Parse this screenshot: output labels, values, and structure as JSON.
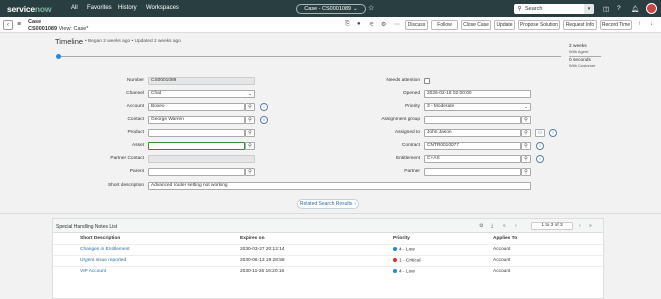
{
  "nav": {
    "logo_service": "service",
    "logo_now": "now",
    "links": [
      "All",
      "Favorites",
      "History",
      "Workspaces"
    ],
    "context_chip": "Case - CS0001089",
    "search_placeholder": "Search"
  },
  "form_header": {
    "record_type": "Case",
    "record_number": "CS0001089",
    "view_label": "View: Case*",
    "buttons": [
      "Discuss",
      "Follow",
      "Close Case",
      "Update",
      "Propose Solution",
      "Request Info",
      "Record Time"
    ]
  },
  "timeline": {
    "title": "Timeline",
    "subtitle": "• Began 2 weeks ago • Updated 2 weeks ago",
    "sla": [
      {
        "value": "2 weeks",
        "label": "With Agent"
      },
      {
        "value": "0 seconds",
        "label": "With Customer"
      }
    ]
  },
  "form": {
    "left": {
      "number": {
        "label": "Number",
        "value": "CS0001089"
      },
      "channel": {
        "label": "Channel",
        "value": "Chat"
      },
      "account": {
        "label": "Account",
        "value": "Boxeo"
      },
      "contact": {
        "label": "Contact",
        "value": "George Warren"
      },
      "product": {
        "label": "Product",
        "value": ""
      },
      "asset": {
        "label": "Asset",
        "value": ""
      },
      "partner_contact": {
        "label": "Partner Contact",
        "value": ""
      },
      "parent": {
        "label": "Parent",
        "value": ""
      },
      "short_description": {
        "label": "Short description",
        "value": "Advanced router setting not working"
      }
    },
    "right": {
      "needs_attention": {
        "label": "Needs attention",
        "checked": false
      },
      "opened": {
        "label": "Opened",
        "value": "2026-02-18 02:00:00"
      },
      "priority": {
        "label": "Priority",
        "value": "3 - Moderate"
      },
      "assignment_group": {
        "label": "Assignment group",
        "value": ""
      },
      "assigned_to": {
        "label": "Assigned to",
        "value": "John Jason"
      },
      "contract": {
        "label": "Contract",
        "value": "CNTR0010077"
      },
      "entitlement": {
        "label": "Entitlement",
        "value": "C+AS"
      },
      "partner": {
        "label": "Partner",
        "value": ""
      }
    }
  },
  "related_search": "Related Search Results",
  "list": {
    "title": "Special Handling Notes List",
    "pager_text": "1  to 3 of 3",
    "columns": [
      "Short Description",
      "Expires on",
      "Priority",
      "Applies To"
    ],
    "rows": [
      {
        "desc": "Changes in Entitlement",
        "expires": "2030-03-27 20:12:14",
        "priority": "4 - Low",
        "applies": "Account",
        "dot": "#1f8ae0"
      },
      {
        "desc": "Urgent issue reported",
        "expires": "2030-06-13 19:28:58",
        "priority": "1 - Critical",
        "applies": "Account",
        "dot": "#d9302c"
      },
      {
        "desc": "VIP Account",
        "expires": "2030-11-26 16:20:16",
        "priority": "4 - Low",
        "applies": "Account",
        "dot": "#1f8ae0"
      }
    ]
  }
}
